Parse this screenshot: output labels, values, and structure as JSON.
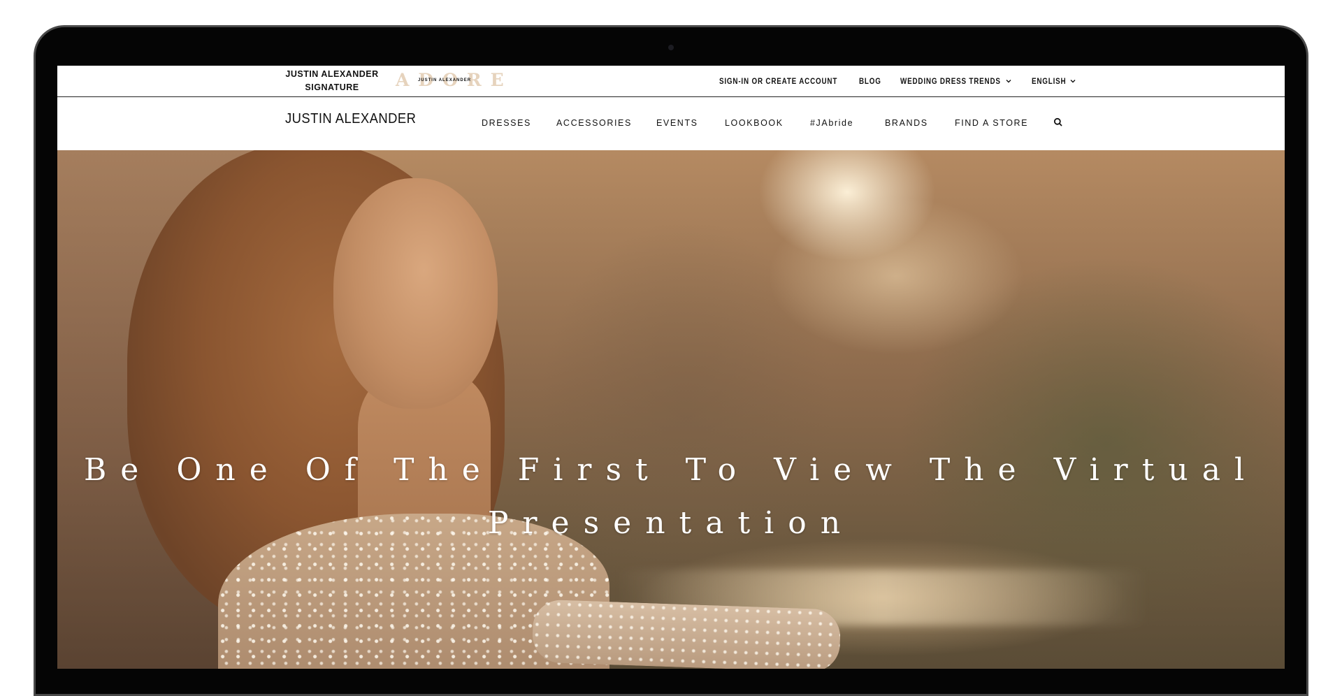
{
  "topbar": {
    "brand_signature": "JUSTIN ALEXANDER\nSIGNATURE",
    "brand_adore": "ADORE",
    "brand_adore_sub": "JUSTIN ALEXANDER",
    "sign_in": "SIGN-IN OR CREATE ACCOUNT",
    "blog": "BLOG",
    "trends": "WEDDING DRESS TRENDS",
    "language": "ENGLISH"
  },
  "mainnav": {
    "logo": "JUSTIN ALEXANDER",
    "items": [
      "DRESSES",
      "ACCESSORIES",
      "EVENTS",
      "LOOKBOOK",
      "#JAbride",
      "BRANDS",
      "FIND A STORE"
    ],
    "search_icon": "search-icon"
  },
  "hero": {
    "headline_line1": "Be One Of The First To View The Virtual",
    "headline_line2": "Presentation"
  },
  "colors": {
    "bezel": "#050505",
    "adore_gold": "#e6d3bd",
    "text": "#111111",
    "hero_text": "#ffffff"
  }
}
